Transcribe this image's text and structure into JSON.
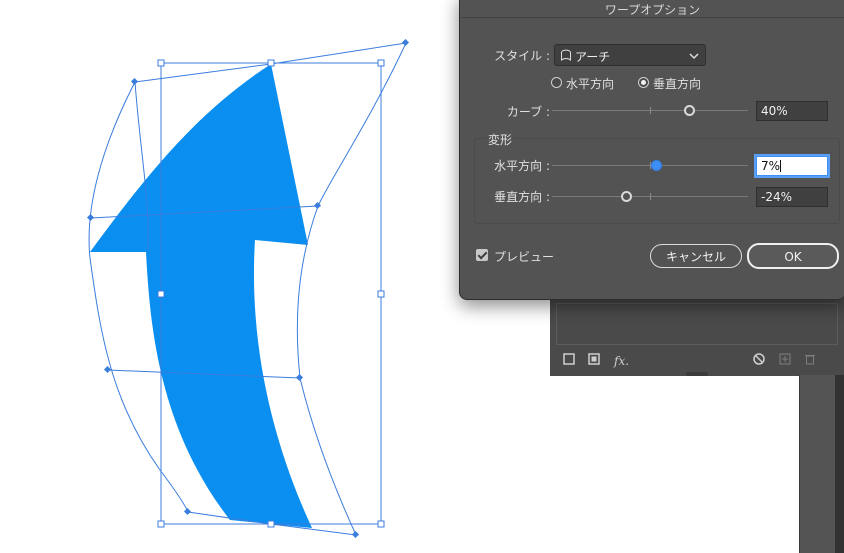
{
  "dialog": {
    "title": "ワープオプション",
    "style_label": "スタイル :",
    "style_value": "アーチ",
    "orientation": {
      "horizontal": "水平方向",
      "vertical": "垂直方向",
      "selected": "vertical"
    },
    "bend": {
      "label": "カーブ :",
      "value": "40%",
      "slider_fraction": 0.7
    },
    "distortion": {
      "label": "変形",
      "horizontal": {
        "label": "水平方向 :",
        "value": "7%",
        "slider_fraction": 0.535
      },
      "vertical": {
        "label": "垂直方向 :",
        "value": "-24%",
        "slider_fraction": 0.38
      }
    },
    "preview": {
      "label": "プレビュー",
      "checked": true
    },
    "cancel_label": "キャンセル",
    "ok_label": "OK"
  },
  "background_panel": {
    "fx_label": "fx."
  },
  "colors": {
    "arrow_fill": "#0a8ff0",
    "bounding_box": "#3b7ddd",
    "dialog_bg": "#535353",
    "slider_accent": "#3f8ef5"
  },
  "icons": [
    "arch-style-icon",
    "chevron-down-icon",
    "square-icon",
    "filled-square-icon",
    "no-entry-icon",
    "new-item-icon",
    "trash-icon"
  ]
}
